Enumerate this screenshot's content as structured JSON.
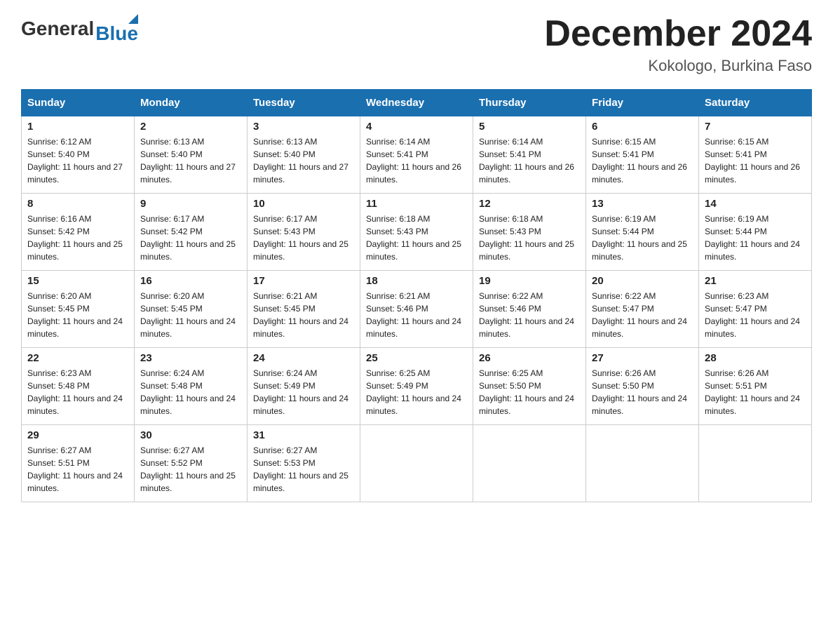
{
  "header": {
    "logo_general": "General",
    "logo_blue": "Blue",
    "month_title": "December 2024",
    "location": "Kokologo, Burkina Faso"
  },
  "weekdays": [
    "Sunday",
    "Monday",
    "Tuesday",
    "Wednesday",
    "Thursday",
    "Friday",
    "Saturday"
  ],
  "weeks": [
    [
      {
        "day": "1",
        "sunrise": "6:12 AM",
        "sunset": "5:40 PM",
        "daylight": "11 hours and 27 minutes."
      },
      {
        "day": "2",
        "sunrise": "6:13 AM",
        "sunset": "5:40 PM",
        "daylight": "11 hours and 27 minutes."
      },
      {
        "day": "3",
        "sunrise": "6:13 AM",
        "sunset": "5:40 PM",
        "daylight": "11 hours and 27 minutes."
      },
      {
        "day": "4",
        "sunrise": "6:14 AM",
        "sunset": "5:41 PM",
        "daylight": "11 hours and 26 minutes."
      },
      {
        "day": "5",
        "sunrise": "6:14 AM",
        "sunset": "5:41 PM",
        "daylight": "11 hours and 26 minutes."
      },
      {
        "day": "6",
        "sunrise": "6:15 AM",
        "sunset": "5:41 PM",
        "daylight": "11 hours and 26 minutes."
      },
      {
        "day": "7",
        "sunrise": "6:15 AM",
        "sunset": "5:41 PM",
        "daylight": "11 hours and 26 minutes."
      }
    ],
    [
      {
        "day": "8",
        "sunrise": "6:16 AM",
        "sunset": "5:42 PM",
        "daylight": "11 hours and 25 minutes."
      },
      {
        "day": "9",
        "sunrise": "6:17 AM",
        "sunset": "5:42 PM",
        "daylight": "11 hours and 25 minutes."
      },
      {
        "day": "10",
        "sunrise": "6:17 AM",
        "sunset": "5:43 PM",
        "daylight": "11 hours and 25 minutes."
      },
      {
        "day": "11",
        "sunrise": "6:18 AM",
        "sunset": "5:43 PM",
        "daylight": "11 hours and 25 minutes."
      },
      {
        "day": "12",
        "sunrise": "6:18 AM",
        "sunset": "5:43 PM",
        "daylight": "11 hours and 25 minutes."
      },
      {
        "day": "13",
        "sunrise": "6:19 AM",
        "sunset": "5:44 PM",
        "daylight": "11 hours and 25 minutes."
      },
      {
        "day": "14",
        "sunrise": "6:19 AM",
        "sunset": "5:44 PM",
        "daylight": "11 hours and 24 minutes."
      }
    ],
    [
      {
        "day": "15",
        "sunrise": "6:20 AM",
        "sunset": "5:45 PM",
        "daylight": "11 hours and 24 minutes."
      },
      {
        "day": "16",
        "sunrise": "6:20 AM",
        "sunset": "5:45 PM",
        "daylight": "11 hours and 24 minutes."
      },
      {
        "day": "17",
        "sunrise": "6:21 AM",
        "sunset": "5:45 PM",
        "daylight": "11 hours and 24 minutes."
      },
      {
        "day": "18",
        "sunrise": "6:21 AM",
        "sunset": "5:46 PM",
        "daylight": "11 hours and 24 minutes."
      },
      {
        "day": "19",
        "sunrise": "6:22 AM",
        "sunset": "5:46 PM",
        "daylight": "11 hours and 24 minutes."
      },
      {
        "day": "20",
        "sunrise": "6:22 AM",
        "sunset": "5:47 PM",
        "daylight": "11 hours and 24 minutes."
      },
      {
        "day": "21",
        "sunrise": "6:23 AM",
        "sunset": "5:47 PM",
        "daylight": "11 hours and 24 minutes."
      }
    ],
    [
      {
        "day": "22",
        "sunrise": "6:23 AM",
        "sunset": "5:48 PM",
        "daylight": "11 hours and 24 minutes."
      },
      {
        "day": "23",
        "sunrise": "6:24 AM",
        "sunset": "5:48 PM",
        "daylight": "11 hours and 24 minutes."
      },
      {
        "day": "24",
        "sunrise": "6:24 AM",
        "sunset": "5:49 PM",
        "daylight": "11 hours and 24 minutes."
      },
      {
        "day": "25",
        "sunrise": "6:25 AM",
        "sunset": "5:49 PM",
        "daylight": "11 hours and 24 minutes."
      },
      {
        "day": "26",
        "sunrise": "6:25 AM",
        "sunset": "5:50 PM",
        "daylight": "11 hours and 24 minutes."
      },
      {
        "day": "27",
        "sunrise": "6:26 AM",
        "sunset": "5:50 PM",
        "daylight": "11 hours and 24 minutes."
      },
      {
        "day": "28",
        "sunrise": "6:26 AM",
        "sunset": "5:51 PM",
        "daylight": "11 hours and 24 minutes."
      }
    ],
    [
      {
        "day": "29",
        "sunrise": "6:27 AM",
        "sunset": "5:51 PM",
        "daylight": "11 hours and 24 minutes."
      },
      {
        "day": "30",
        "sunrise": "6:27 AM",
        "sunset": "5:52 PM",
        "daylight": "11 hours and 25 minutes."
      },
      {
        "day": "31",
        "sunrise": "6:27 AM",
        "sunset": "5:53 PM",
        "daylight": "11 hours and 25 minutes."
      },
      null,
      null,
      null,
      null
    ]
  ],
  "labels": {
    "sunrise_prefix": "Sunrise: ",
    "sunset_prefix": "Sunset: ",
    "daylight_prefix": "Daylight: "
  }
}
